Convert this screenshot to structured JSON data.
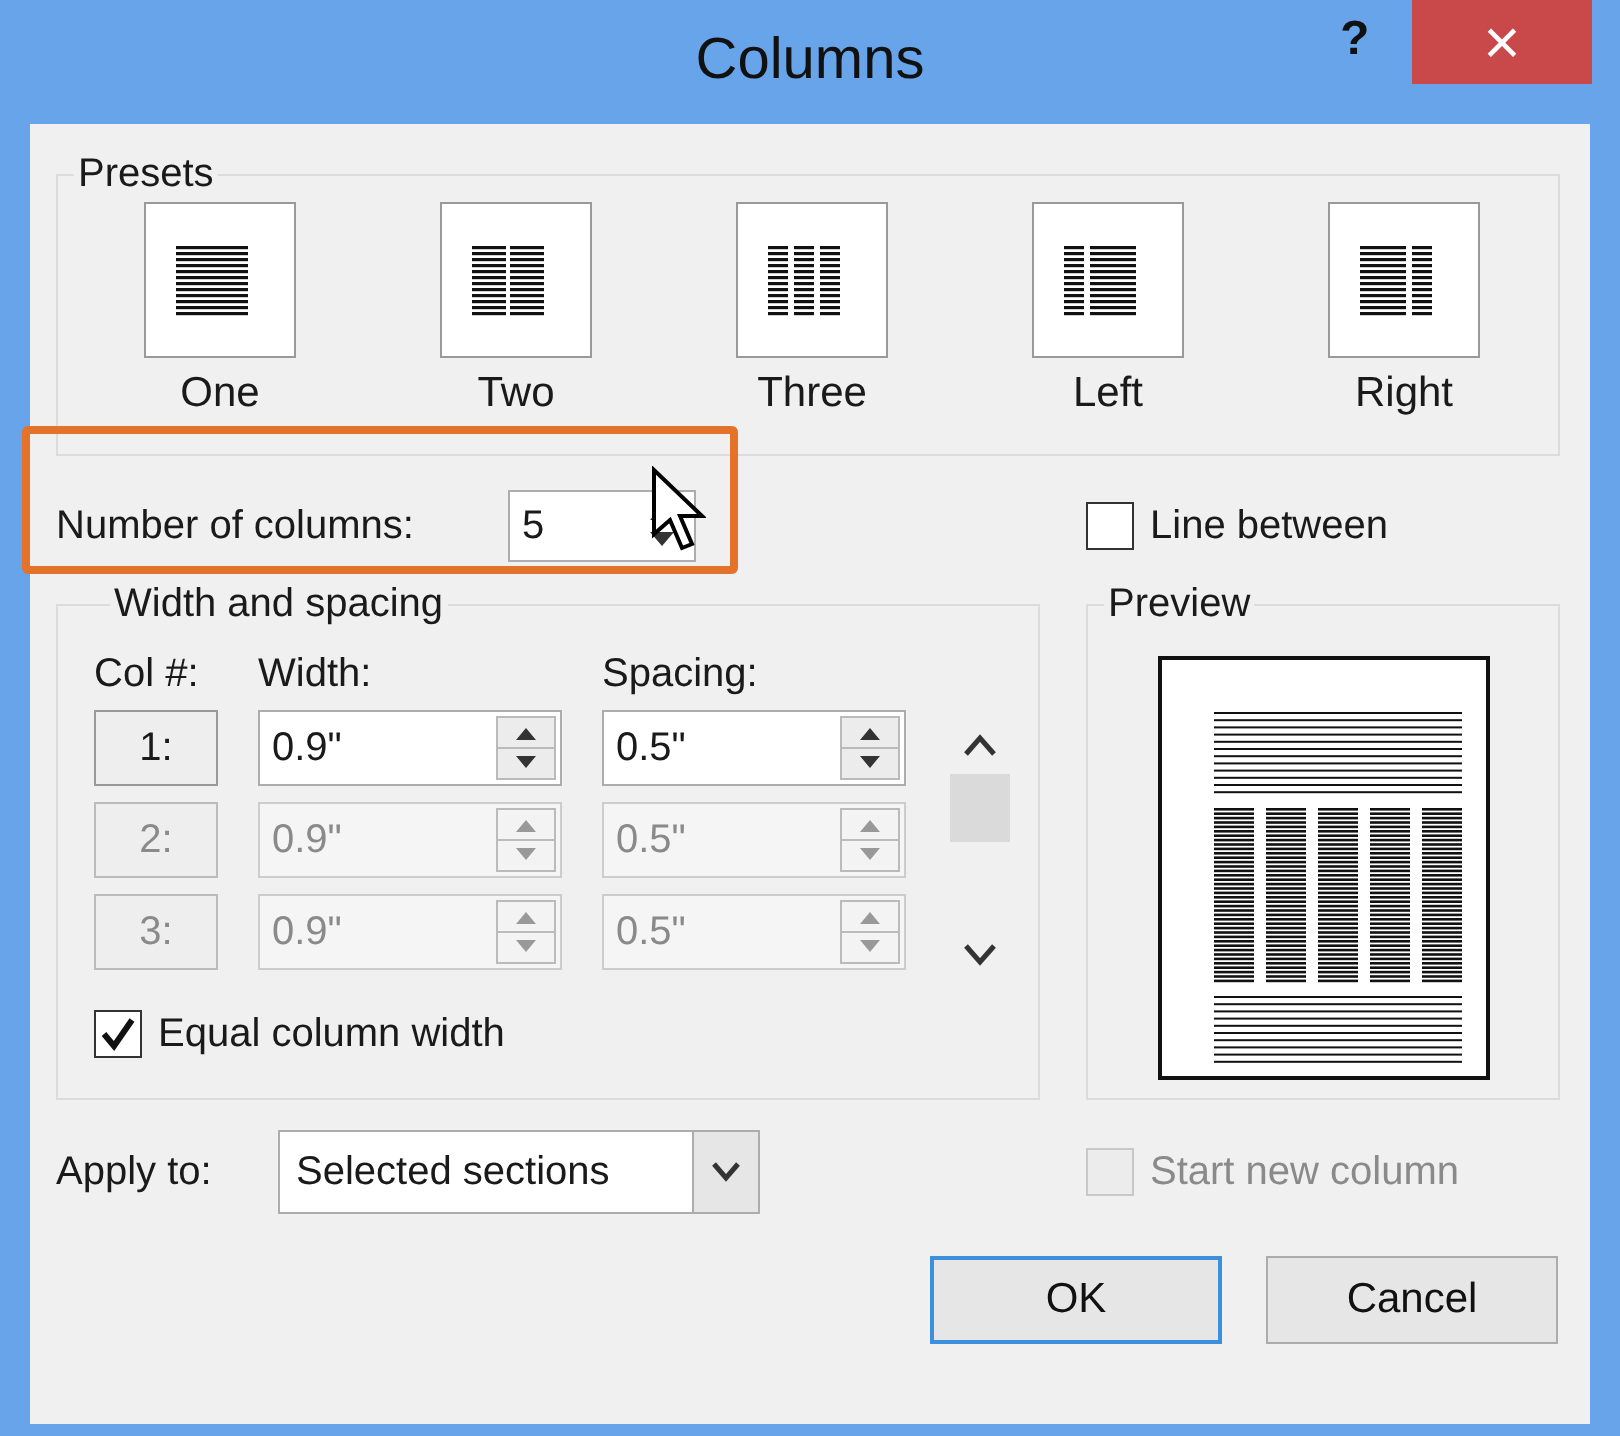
{
  "window": {
    "title": "Columns",
    "help": "?",
    "close": "×"
  },
  "presets": {
    "label": "Presets",
    "items": [
      {
        "kind": "one",
        "label": "One"
      },
      {
        "kind": "two",
        "label": "Two"
      },
      {
        "kind": "three",
        "label": "Three"
      },
      {
        "kind": "left",
        "label": "Left"
      },
      {
        "kind": "right",
        "label": "Right"
      }
    ]
  },
  "number_of_columns": {
    "label": "Number of columns:",
    "value": "5",
    "highlighted": true
  },
  "line_between": {
    "label": "Line between",
    "checked": false,
    "disabled": false
  },
  "width_and_spacing": {
    "label": "Width and spacing",
    "headers": [
      "Col #:",
      "Width:",
      "Spacing:"
    ],
    "rows": [
      {
        "col": "1:",
        "width": "0.9\"",
        "spacing": "0.5\"",
        "disabled": false
      },
      {
        "col": "2:",
        "width": "0.9\"",
        "spacing": "0.5\"",
        "disabled": true
      },
      {
        "col": "3:",
        "width": "0.9\"",
        "spacing": "0.5\"",
        "disabled": true
      }
    ],
    "equal_width": {
      "label": "Equal column width",
      "checked": true,
      "disabled": false
    }
  },
  "preview": {
    "label": "Preview"
  },
  "apply_to": {
    "label": "Apply to:",
    "value": "Selected sections"
  },
  "start_new_column": {
    "label": "Start new column",
    "checked": false,
    "disabled": true
  },
  "buttons": [
    {
      "label": "OK",
      "focused": true
    },
    {
      "label": "Cancel",
      "focused": false
    }
  ]
}
